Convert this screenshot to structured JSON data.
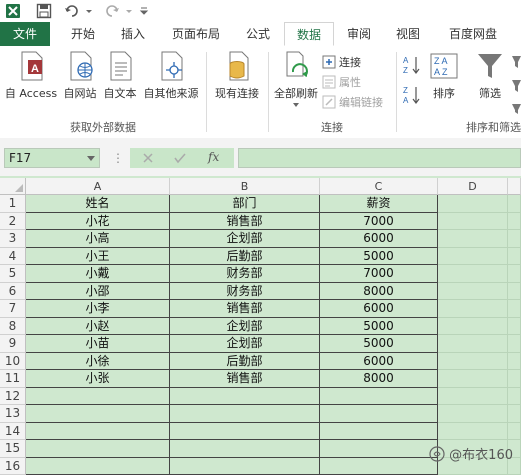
{
  "tabs": [
    "文件",
    "开始",
    "插入",
    "页面布局",
    "公式",
    "数据",
    "审阅",
    "视图",
    "百度网盘"
  ],
  "active_tab": "数据",
  "ribbon": {
    "get_external": {
      "buttons": [
        "自 Access",
        "自网站",
        "自文本",
        "自其他来源"
      ],
      "label": "获取外部数据"
    },
    "existing_connections": "现有连接",
    "connections": {
      "refresh_all": "全部刷新",
      "connections": "连接",
      "properties": "属性",
      "edit_links": "编辑链接",
      "label": "连接"
    },
    "sort_filter": {
      "sort": "排序",
      "filter": "筛选",
      "label": "排序和筛选"
    }
  },
  "name_box": "F17",
  "fx_label": "fx",
  "columns": [
    "A",
    "B",
    "C",
    "D"
  ],
  "rows": [
    "1",
    "2",
    "3",
    "4",
    "5",
    "6",
    "7",
    "8",
    "9",
    "10",
    "11",
    "12",
    "13",
    "14",
    "15",
    "16"
  ],
  "table": [
    [
      "姓名",
      "部门",
      "薪资"
    ],
    [
      "小花",
      "销售部",
      "7000"
    ],
    [
      "小高",
      "企划部",
      "6000"
    ],
    [
      "小王",
      "后勤部",
      "5000"
    ],
    [
      "小戴",
      "财务部",
      "7000"
    ],
    [
      "小邵",
      "财务部",
      "8000"
    ],
    [
      "小李",
      "销售部",
      "6000"
    ],
    [
      "小赵",
      "企划部",
      "5000"
    ],
    [
      "小苗",
      "企划部",
      "5000"
    ],
    [
      "小徐",
      "后勤部",
      "6000"
    ],
    [
      "小张",
      "销售部",
      "8000"
    ]
  ],
  "watermark": "@布衣160",
  "colors": {
    "excel_green": "#217346",
    "cell_green": "#cfe8cf",
    "access_red": "#a4373a"
  }
}
